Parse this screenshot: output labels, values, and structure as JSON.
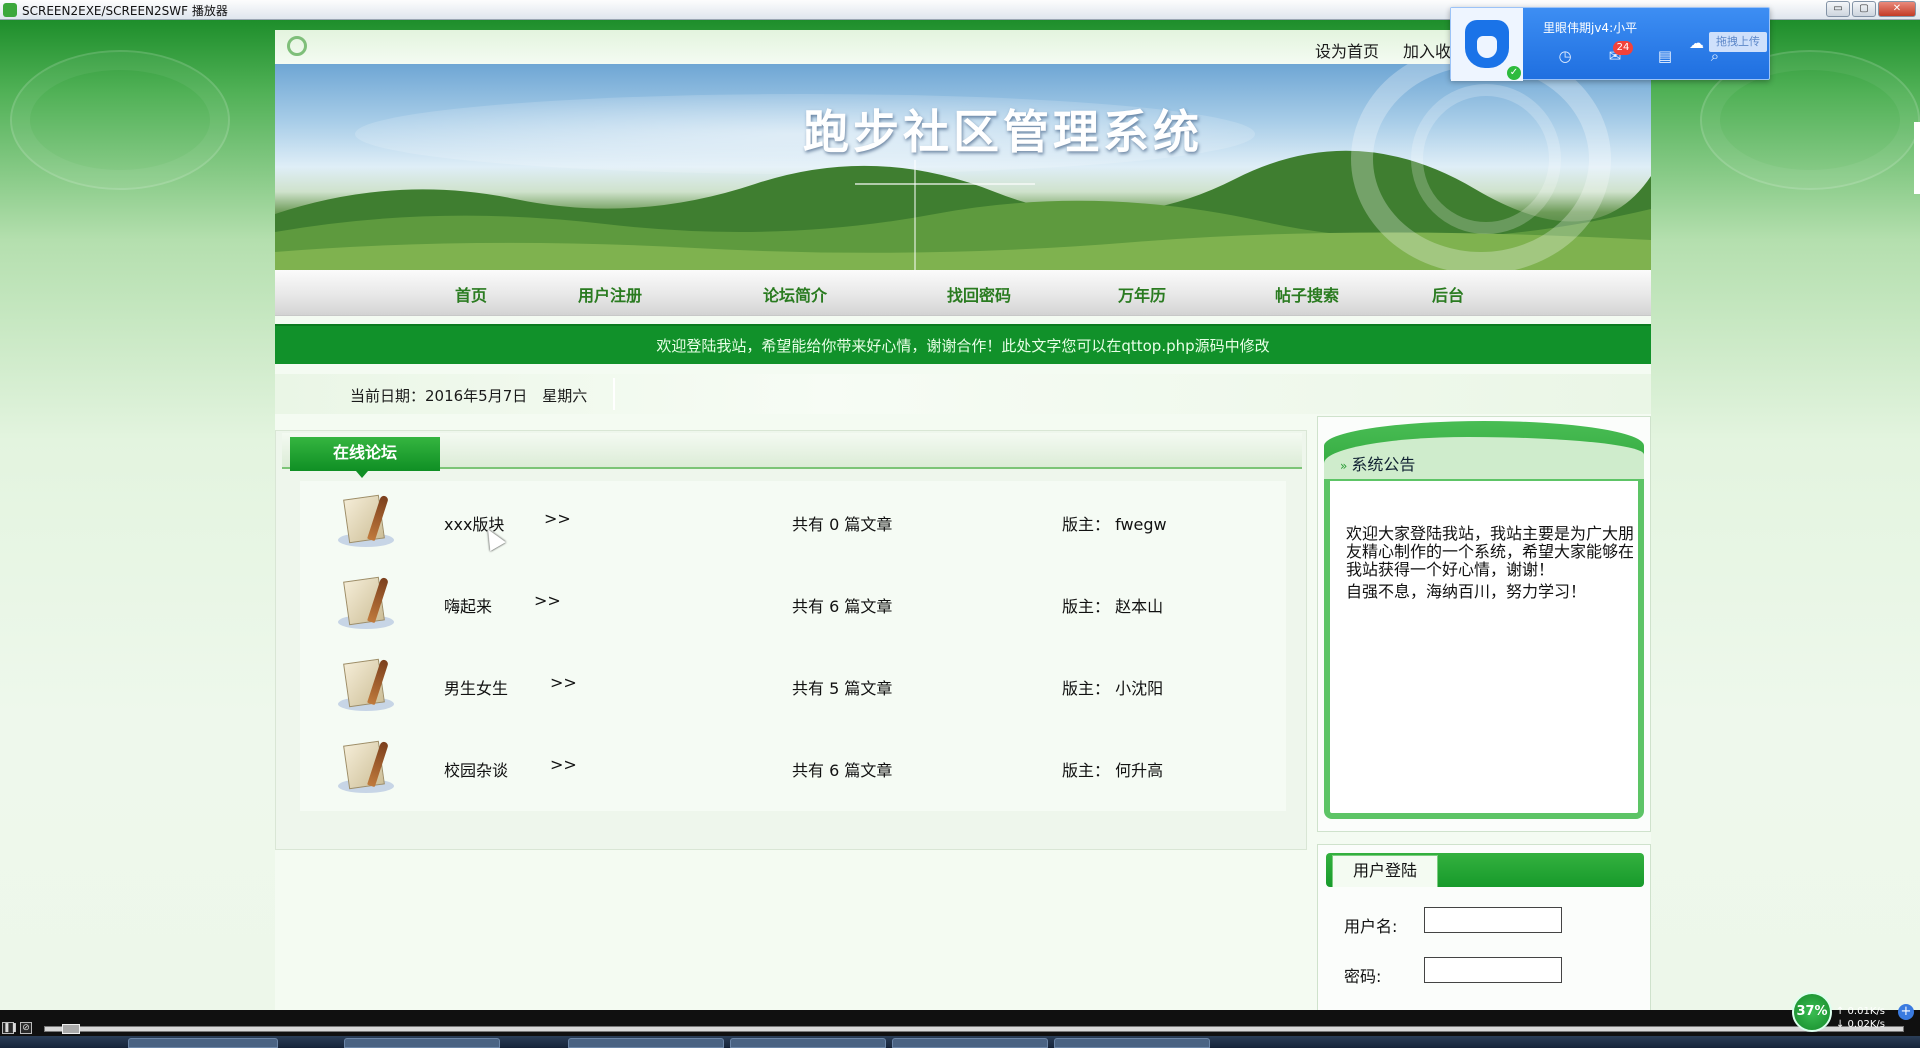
{
  "player": {
    "title": "SCREEN2EXE/SCREEN2SWF 播放器",
    "window_buttons": [
      "▭",
      "▢",
      "✕"
    ]
  },
  "top_links": [
    "设为首页",
    "加入收"
  ],
  "site": {
    "title": "跑步社区管理系统",
    "nav": [
      "首页",
      "用户注册",
      "论坛简介",
      "找回密码",
      "万年历",
      "帖子搜索",
      "后台"
    ],
    "marquee": "欢迎登陆我站，希望能给你带来好心情，谢谢合作！此处文字您可以在qttop.php源码中修改",
    "date_line": "当前日期：2016年5月7日　星期六"
  },
  "forum": {
    "tab_title": "在线论坛",
    "arrow": ">>",
    "rows": [
      {
        "name": "xxx版块",
        "count": "共有 0 篇文章",
        "moderator": "版主： fwegw"
      },
      {
        "name": "嗨起来",
        "count": "共有 6 篇文章",
        "moderator": "版主： 赵本山"
      },
      {
        "name": "男生女生",
        "count": "共有 5 篇文章",
        "moderator": "版主： 小沈阳"
      },
      {
        "name": "校园杂谈",
        "count": "共有 6 篇文章",
        "moderator": "版主： 何升高"
      }
    ]
  },
  "notice": {
    "title": "系统公告",
    "paragraph1": "欢迎大家登陆我站，我站主要是为广大朋友精心制作的一个系统，希望大家能够在我站获得一个好心情，谢谢！",
    "paragraph2": "自强不息，海纳百川，努力学习！"
  },
  "login": {
    "title": "用户登陆",
    "username_label": "用户名:",
    "password_label": "密码:"
  },
  "popup": {
    "username": "里眼伟期jv4:小平",
    "mail_badge": "24",
    "upload_label": "拖拽上传"
  },
  "netmon": {
    "percent": "37%",
    "up": "↑ 0.01K/s",
    "down": "↓ 0.02K/s"
  }
}
